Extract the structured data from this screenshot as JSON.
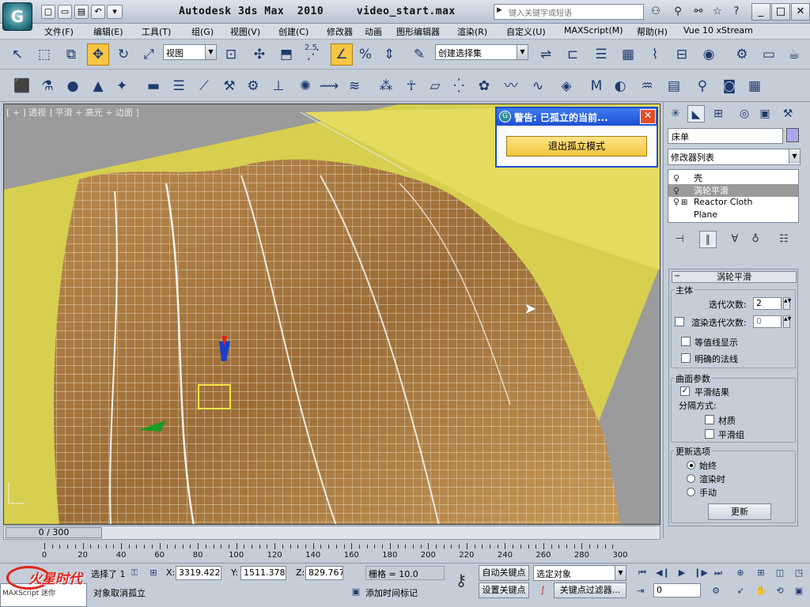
{
  "app": {
    "title": "Autodesk 3ds Max  2010     video_start.max",
    "logo_letter": "G"
  },
  "search": {
    "placeholder": "键入关键字或短语"
  },
  "menu": [
    "文件(F)",
    "编辑(E)",
    "工具(T)",
    "组(G)",
    "视图(V)",
    "创建(C)",
    "修改器",
    "动画",
    "图形编辑器",
    "渲染(R)",
    "自定义(U)",
    "MAXScript(M)",
    "帮助(H)",
    "Vue 10 xStream"
  ],
  "toolbar": {
    "view_dropdown": "视图",
    "selection_set_dropdown": "创建选择集",
    "snap_label": "2.5"
  },
  "viewport": {
    "label": "[ + ] 透视 ] 平滑 + 高光 + 边面 ]",
    "bg_color": "#d8d35a"
  },
  "isolate_dialog": {
    "title": "警告: 已孤立的当前...",
    "exit_button": "退出孤立模式"
  },
  "command_panel": {
    "object_name": "床单",
    "object_color": "#a8a8f0",
    "modifier_list": "修改器列表",
    "stack": [
      {
        "label": "壳",
        "selected": false,
        "has_bulb": true,
        "has_plus": false
      },
      {
        "label": "涡轮平滑",
        "selected": true,
        "has_bulb": true,
        "has_plus": false
      },
      {
        "label": "Reactor Cloth",
        "selected": false,
        "has_bulb": true,
        "has_plus": true
      },
      {
        "label": "Plane",
        "selected": false,
        "has_bulb": false,
        "has_plus": false
      }
    ],
    "rollout": {
      "title": "涡轮平滑",
      "main_group": "主体",
      "iterations_label": "迭代次数:",
      "iterations_value": "2",
      "render_iters_label": "渲染迭代次数:",
      "render_iters_value": "0",
      "render_iters_checked": false,
      "isoline_label": "等值线显示",
      "isoline_checked": false,
      "explicit_normals_label": "明确的法线",
      "explicit_normals_checked": false,
      "surface_group": "曲面参数",
      "smooth_result_label": "平滑结果",
      "smooth_result_checked": true,
      "separate_by_label": "分隔方式:",
      "material_label": "材质",
      "material_checked": false,
      "smoothing_groups_label": "平滑组",
      "smoothing_groups_checked": false,
      "update_group": "更新选项",
      "update_always_label": "始终",
      "update_render_label": "渲染时",
      "update_manual_label": "手动",
      "update_selected": "always",
      "update_button": "更新"
    }
  },
  "timeline": {
    "current": "0 / 300",
    "progress": 0,
    "ticks": [
      "0",
      "20",
      "40",
      "60",
      "80",
      "100",
      "120",
      "140",
      "160",
      "180",
      "200",
      "220",
      "240",
      "260",
      "280",
      "300"
    ]
  },
  "status": {
    "selected_text": "选择了 1",
    "prompt_text": "对象取消孤立",
    "x_label": "X:",
    "x_value": "3319.422",
    "y_label": "Y:",
    "y_value": "1511.378",
    "z_label": "Z:",
    "z_value": "829.767",
    "grid_text": "栅格 = 10.0",
    "add_time_tag": "添加时间标记",
    "auto_key": "自动关键点",
    "set_key": "设置关键点",
    "selected_object_dd": "选定对象",
    "key_filters": "关键点过滤器...",
    "frame_value": "0",
    "watermark": "火星时代"
  }
}
